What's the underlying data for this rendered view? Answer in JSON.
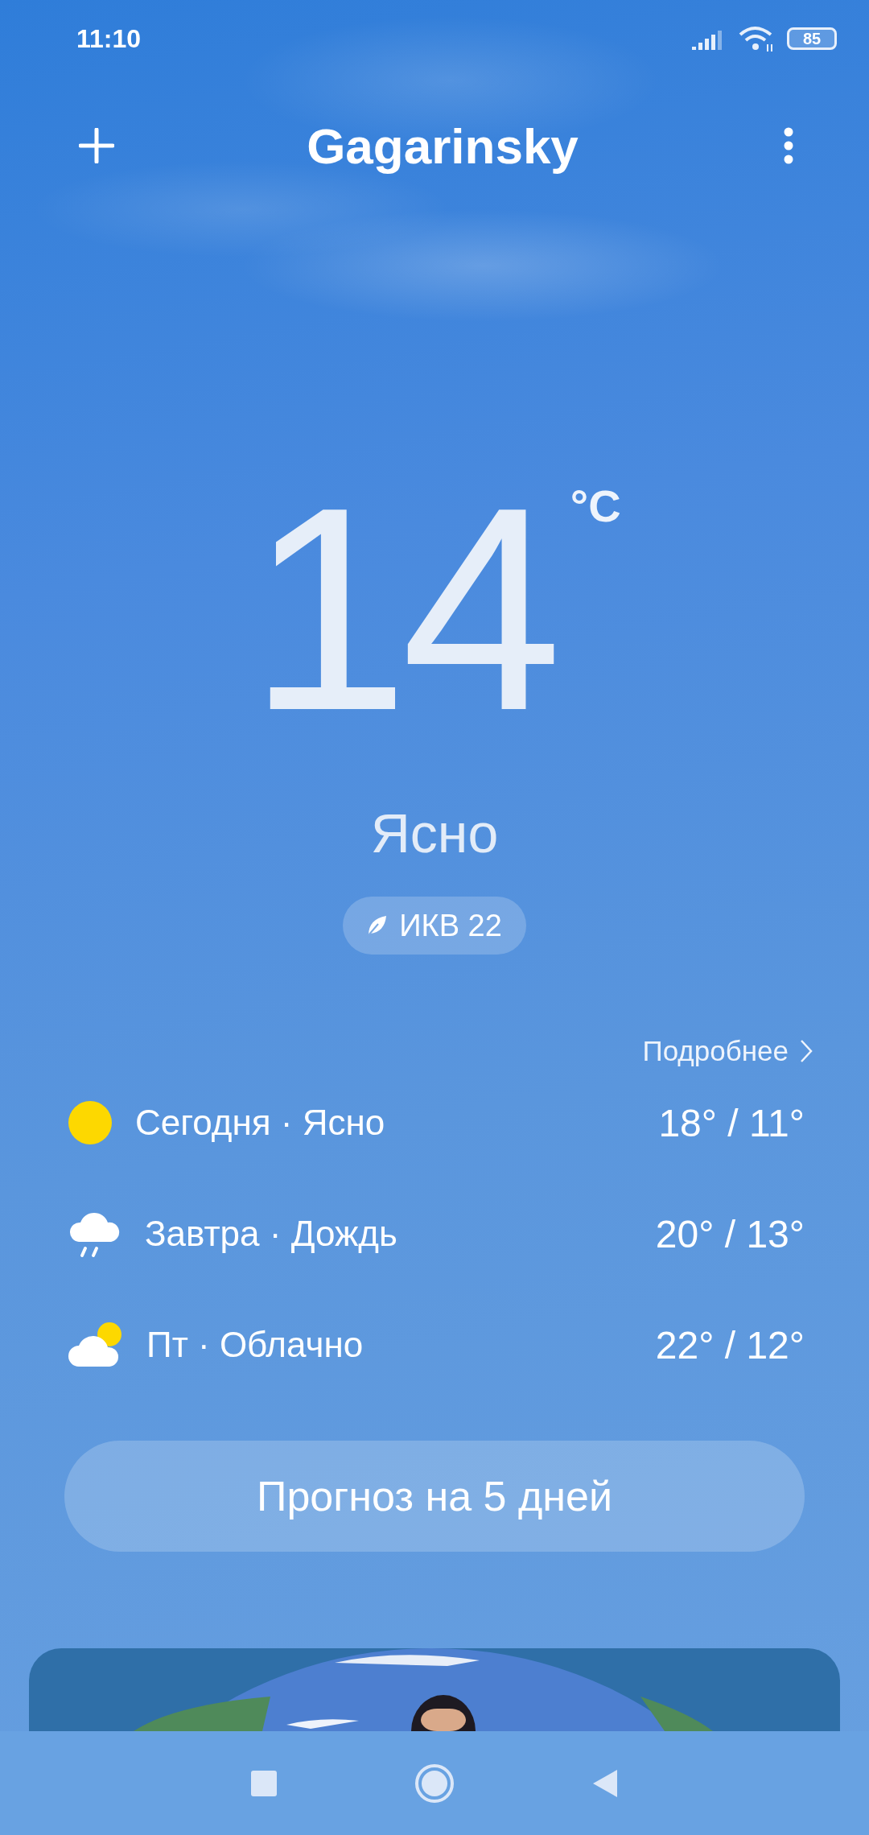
{
  "status_bar": {
    "time": "11:10",
    "battery": "85"
  },
  "header": {
    "title": "Gagarinsky"
  },
  "current": {
    "temperature": "14",
    "unit": "°C",
    "condition": "Ясно",
    "aqi": "ИКВ 22"
  },
  "details_link": "Подробнее",
  "forecast": [
    {
      "kind": "sunny",
      "label": "Сегодня · Ясно",
      "temps": "18° / 11°"
    },
    {
      "kind": "rain",
      "label": "Завтра · Дождь",
      "temps": "20° / 13°"
    },
    {
      "kind": "partly_cloudy",
      "label": "Пт · Облачно",
      "temps": "22° / 12°"
    }
  ],
  "forecast_button": "Прогноз на 5 дней"
}
